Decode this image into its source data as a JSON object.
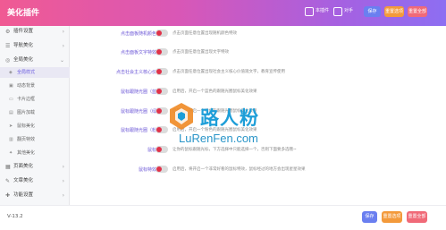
{
  "app": {
    "title": "美化插件",
    "version": "V-13.2"
  },
  "colors": {
    "accent": "#6a5ae0",
    "header_gradient_start": "#f05a93",
    "header_gradient_end": "#8d6ef2",
    "toggle_knob": "#e0324a",
    "save_button": "#6a7ff0",
    "reset_button": "#f39a3b",
    "reset_all_button": "#f06a78"
  },
  "header": {
    "checkboxes": [
      {
        "label": "本插件"
      },
      {
        "label": "对手"
      }
    ],
    "buttons": {
      "save": "保存",
      "reset": "重置选项",
      "reset_all": "重置全部"
    }
  },
  "sidebar": {
    "items": [
      {
        "label": "插件设置",
        "icon": "gear-icon",
        "glyph": "⚙",
        "expandable": true
      },
      {
        "label": "导航美化",
        "icon": "menu-icon",
        "glyph": "☰",
        "expandable": true
      },
      {
        "label": "全局美化",
        "icon": "globe-icon",
        "glyph": "◎",
        "expandable": true,
        "expanded": true
      }
    ],
    "subitems": [
      {
        "label": "全局样式",
        "icon": "palette-icon",
        "glyph": "◈",
        "active": true
      },
      {
        "label": "动态背景",
        "icon": "image-icon",
        "glyph": "▣"
      },
      {
        "label": "卡片边框",
        "icon": "card-icon",
        "glyph": "▭"
      },
      {
        "label": "图片加载",
        "icon": "picture-icon",
        "glyph": "▤"
      },
      {
        "label": "鼠标美化",
        "icon": "cursor-icon",
        "glyph": "➤"
      },
      {
        "label": "翻页特效",
        "icon": "page-icon",
        "glyph": "▥"
      },
      {
        "label": "其他美化",
        "icon": "star-icon",
        "glyph": "✦"
      }
    ],
    "bottom_items": [
      {
        "label": "页面美化",
        "icon": "layout-icon",
        "glyph": "▦",
        "expandable": true
      },
      {
        "label": "文章美化",
        "icon": "article-icon",
        "glyph": "✎",
        "expandable": true
      },
      {
        "label": "功能设置",
        "icon": "tools-icon",
        "glyph": "✚",
        "expandable": true
      }
    ]
  },
  "settings": [
    {
      "label": "点击面板随机颜色特效",
      "description": "点击页面任意位置出现随机颜色特效",
      "enabled": false
    },
    {
      "label": "点击面板文字特效开关",
      "description": "点击页面任意位置出现文字特效",
      "enabled": false
    },
    {
      "label": "点击社会主义核心价值观",
      "description": "点击页面任意位置出现社会主义核心价值观文字，教育宣传使用",
      "enabled": false
    },
    {
      "label": "鼠标跟随光圈（蓝色）",
      "description": "启用后，开启一个蓝色的跟随光圈鼠标美化效果",
      "enabled": false
    },
    {
      "label": "鼠标跟随光圈（绿色）",
      "description": "启用后，开启一个绿色的跟随光圈鼠标美化效果",
      "enabled": false
    },
    {
      "label": "鼠标跟随光圈（粉色）",
      "description": "启用后，开启一个粉色的跟随光圈鼠标美化效果",
      "enabled": false
    },
    {
      "label": "鼠标跟随",
      "description": "让你的鼠标跟随光标，下方选择中只能选择一个，否则下面要多选哦~",
      "enabled": false
    },
    {
      "label": "鼠标特效星星",
      "description": "启用后，将开启一个非常好看的鼠标特效，鼠标经过的地方会出现星星效果",
      "enabled": false
    }
  ],
  "watermark": {
    "text": "路人粉",
    "url": "LuRenFen.com"
  },
  "footer": {
    "buttons": {
      "save": "保存",
      "reset": "重置选项",
      "reset_all": "重置全部"
    }
  }
}
